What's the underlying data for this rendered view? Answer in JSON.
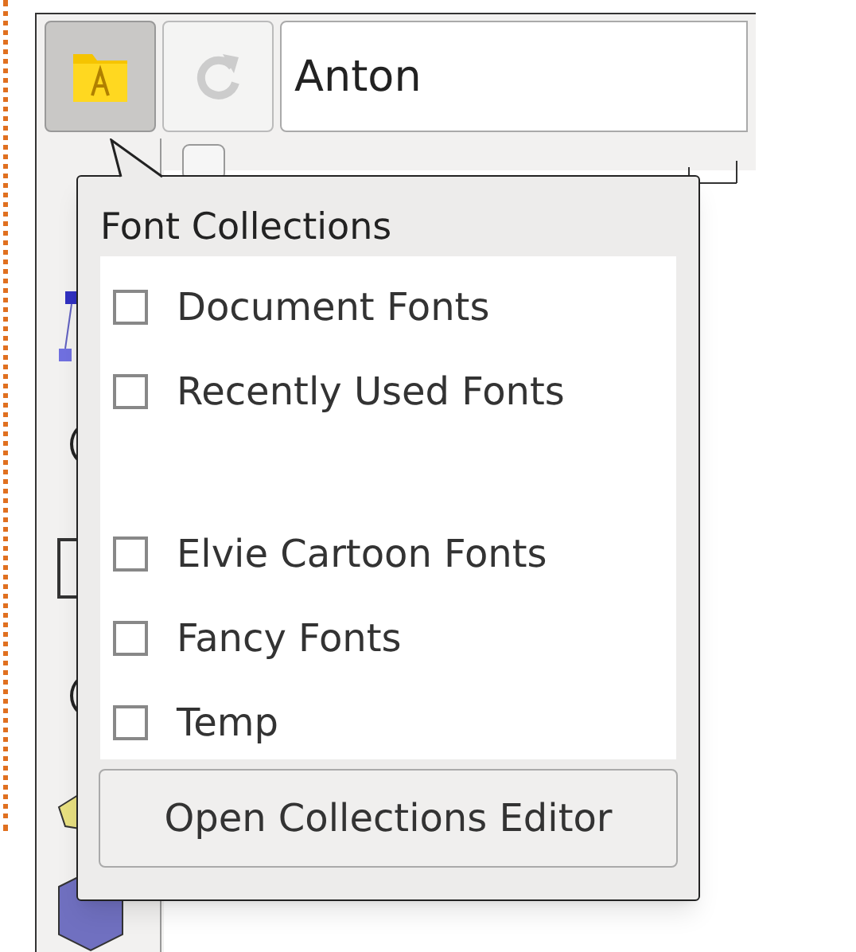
{
  "toolbar": {
    "buttons": [
      {
        "kind": "collections",
        "pressed": true
      },
      {
        "kind": "refresh",
        "pressed": false
      }
    ],
    "font_field": {
      "value": "Anton"
    }
  },
  "popup": {
    "title": "Font Collections",
    "groups": [
      [
        {
          "label": "Document Fonts",
          "checked": false
        },
        {
          "label": "Recently Used Fonts",
          "checked": false
        }
      ],
      [
        {
          "label": "Elvie Cartoon Fonts",
          "checked": false
        },
        {
          "label": "Fancy Fonts",
          "checked": false
        },
        {
          "label": "Temp",
          "checked": false
        }
      ]
    ],
    "button": "Open Collections Editor"
  }
}
